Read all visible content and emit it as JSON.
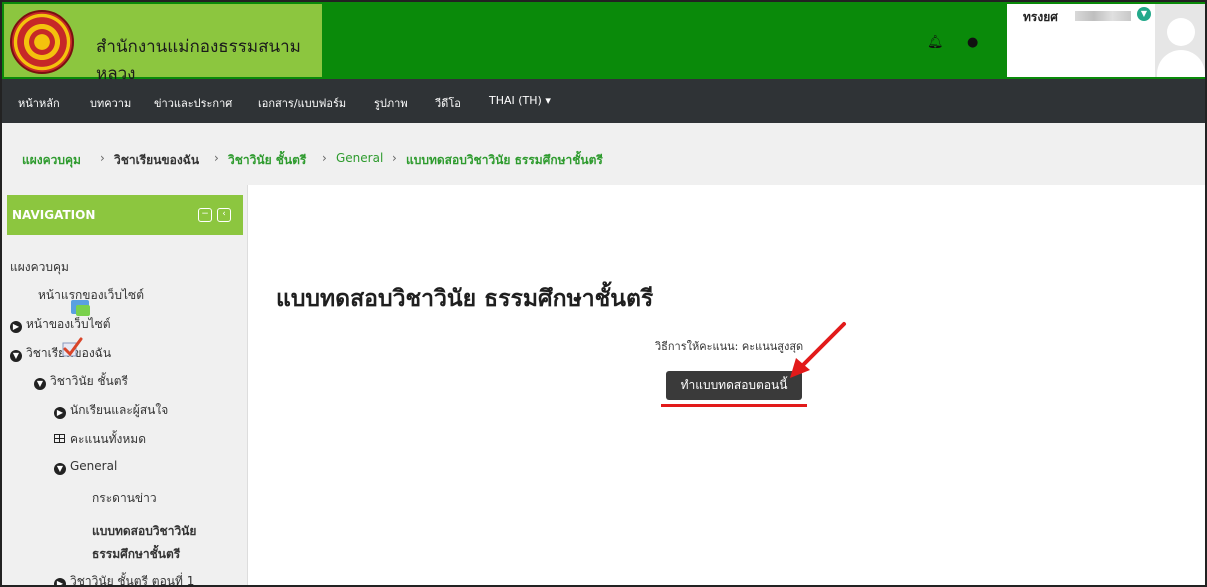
{
  "header": {
    "site_name": "สำนักงานแม่กองธรรมสนามหลวง",
    "bell_icon": "bell-icon",
    "chat_icon": "chat-icon",
    "user_name": "ทรงยศ",
    "colors": {
      "header": "#0a8a0a",
      "brand": "#8cc63f"
    }
  },
  "navbar": {
    "items": [
      "หน้าหลัก",
      "บทความ",
      "ข่าวและประกาศ",
      "เอกสาร/แบบฟอร์ม",
      "รูปภาพ",
      "วีดีโอ",
      "THAI (TH) ▾"
    ]
  },
  "breadcrumb": {
    "items": [
      "แผงควบคุม",
      "วิชาเรียนของฉัน",
      "วิชาวินัย ชั้นตรี",
      "General",
      "แบบทดสอบวิชาวินัย ธรรมศึกษาชั้นตรี"
    ],
    "separator": "›"
  },
  "sidebar": {
    "title": "NAVIGATION",
    "items": [
      "แผงควบคุม",
      "หน้าแรกของเว็บไซต์",
      "หน้าของเว็บไซต์",
      "วิชาเรียนของฉัน",
      "วิชาวินัย ชั้นตรี",
      "นักเรียนและผู้สนใจ",
      "คะแนนทั้งหมด",
      "General",
      "กระดานข่าว",
      "แบบทดสอบวิชาวินัย",
      "ธรรมศึกษาชั้นตรี",
      "วิชาวินัย ชั้นตรี ตอนที่ 1"
    ]
  },
  "main": {
    "title": "แบบทดสอบวิชาวินัย ธรรมศึกษาชั้นตรี",
    "grading_method": "วิธีการให้คะแนน: คะแนนสูงสุด",
    "attempt_button": "ทำแบบทดสอบตอนนี้",
    "annotation_color": "#e21a1a"
  }
}
